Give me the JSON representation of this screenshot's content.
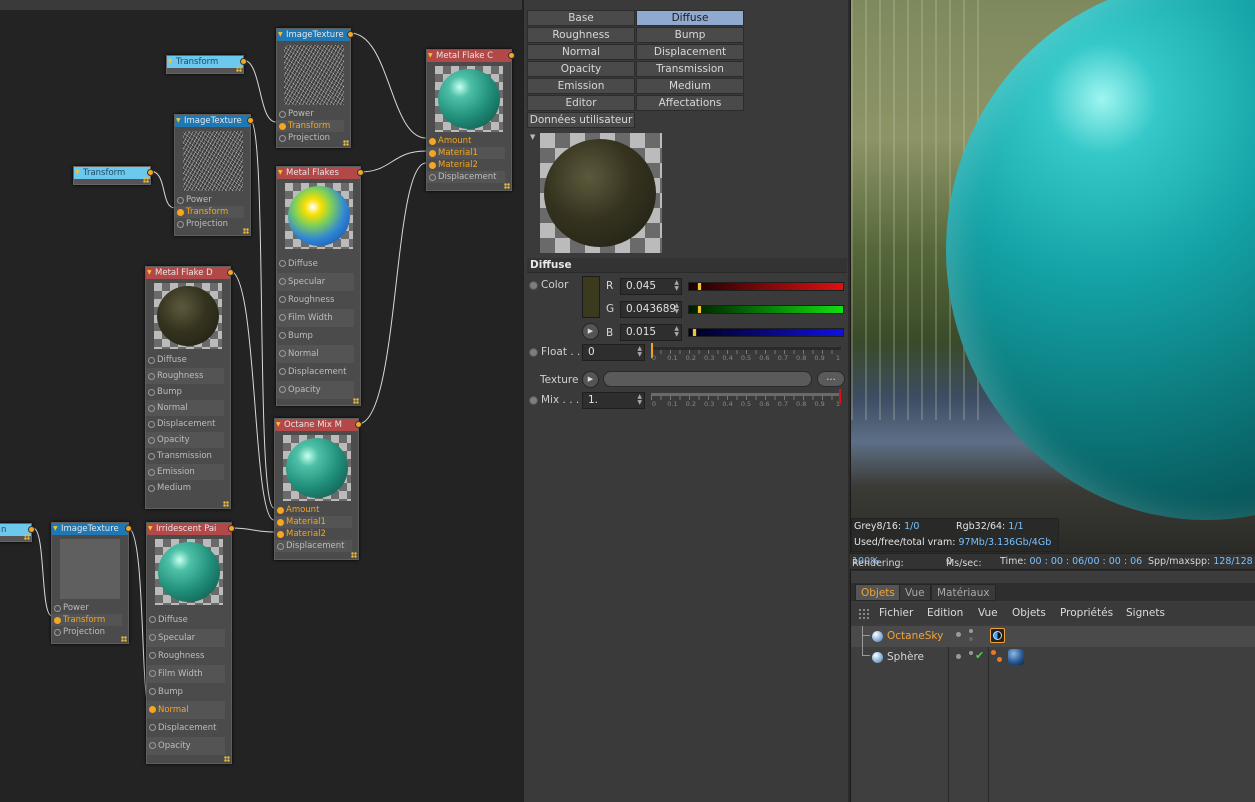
{
  "node_editor": {
    "nodes": {
      "transform_top": {
        "title": "Transform"
      },
      "transform_mid": {
        "title": "Transform"
      },
      "transform_left": {
        "title": "n"
      },
      "imagetex_top": {
        "title": "ImageTexture",
        "ports": [
          "Power",
          "Transform",
          "Projection"
        ]
      },
      "imagetex_mid": {
        "title": "ImageTexture",
        "ports": [
          "Power",
          "Transform",
          "Projection"
        ]
      },
      "imagetex_bottom": {
        "title": "ImageTexture",
        "ports": [
          "Power",
          "Transform",
          "Projection"
        ]
      },
      "metal_flake_c": {
        "title": "Metal Flake C",
        "ports": [
          "Amount",
          "Material1",
          "Material2",
          "Displacement"
        ]
      },
      "metal_flakes": {
        "title": "Metal Flakes",
        "ports": [
          "Diffuse",
          "Specular",
          "Roughness",
          "Film Width",
          "Bump",
          "Normal",
          "Displacement",
          "Opacity"
        ]
      },
      "metal_flake_d": {
        "title": "Metal Flake D",
        "ports": [
          "Diffuse",
          "Roughness",
          "Bump",
          "Normal",
          "Displacement",
          "Opacity",
          "Transmission",
          "Emission",
          "Medium"
        ]
      },
      "octane_mix": {
        "title": "Octane Mix M",
        "ports": [
          "Amount",
          "Material1",
          "Material2",
          "Displacement"
        ]
      },
      "iridescent": {
        "title": "Irridescent Pai",
        "ports": [
          "Diffuse",
          "Specular",
          "Roughness",
          "Film Width",
          "Bump",
          "Normal",
          "Displacement",
          "Opacity"
        ]
      }
    }
  },
  "attributes": {
    "tabs": [
      {
        "label": "Base"
      },
      {
        "label": "Diffuse"
      },
      {
        "label": "Roughness"
      },
      {
        "label": "Bump"
      },
      {
        "label": "Normal"
      },
      {
        "label": "Displacement"
      },
      {
        "label": "Opacity"
      },
      {
        "label": "Transmission"
      },
      {
        "label": "Emission"
      },
      {
        "label": "Medium"
      },
      {
        "label": "Editor"
      },
      {
        "label": "Affectations"
      },
      {
        "label": "Données utilisateur"
      }
    ],
    "active_tab": "Diffuse",
    "section_title": "Diffuse",
    "color_label": "Color",
    "r_label": "R",
    "r_value": "0.045",
    "g_label": "G",
    "g_value": "0.043689",
    "b_label": "B",
    "b_value": "0.015",
    "float_label": "Float . .",
    "float_value": "0",
    "texture_label": "Texture",
    "texture_button": "...",
    "mix_label": "Mix . . .",
    "mix_value": "1.",
    "scale_ticks": [
      "0",
      "0.1",
      "0.2",
      "0.3",
      "0.4",
      "0.5",
      "0.6",
      "0.7",
      "0.8",
      "0.9",
      "1"
    ],
    "r_fraction": 0.045,
    "g_fraction": 0.043689,
    "b_fraction": 0.015,
    "float_fraction": 0,
    "mix_fraction": 1,
    "swatch_color": "#3b3a1f"
  },
  "render": {
    "grey_label": "Grey8/16:",
    "grey_value": "1/0",
    "rgb_label": "Rgb32/64:",
    "rgb_value": "1/1",
    "vram_label": "Used/free/total vram:",
    "vram_value": "97Mb/3.136Gb/4Gb",
    "rendering_label": "Rendering:",
    "rendering_value": "100%",
    "ms_label": "Ms/sec:",
    "ms_value": "0",
    "time_label": "Time:",
    "time_value": "00 : 00 : 06/00 : 00 : 06",
    "spp_label": "Spp/maxspp:",
    "spp_value": "128/128"
  },
  "object_manager": {
    "tabs": [
      {
        "label": "Objets"
      },
      {
        "label": "Vue"
      },
      {
        "label": "Matériaux"
      }
    ],
    "menu": [
      "Fichier",
      "Edition",
      "Vue",
      "Objets",
      "Propriétés",
      "Signets"
    ],
    "objects": [
      {
        "name": "OctaneSky"
      },
      {
        "name": "Sphère"
      }
    ]
  },
  "colors": {
    "accent_orange": "#f5a623",
    "value_blue": "#79c2ff",
    "active_tab": "#8fa9cf"
  }
}
